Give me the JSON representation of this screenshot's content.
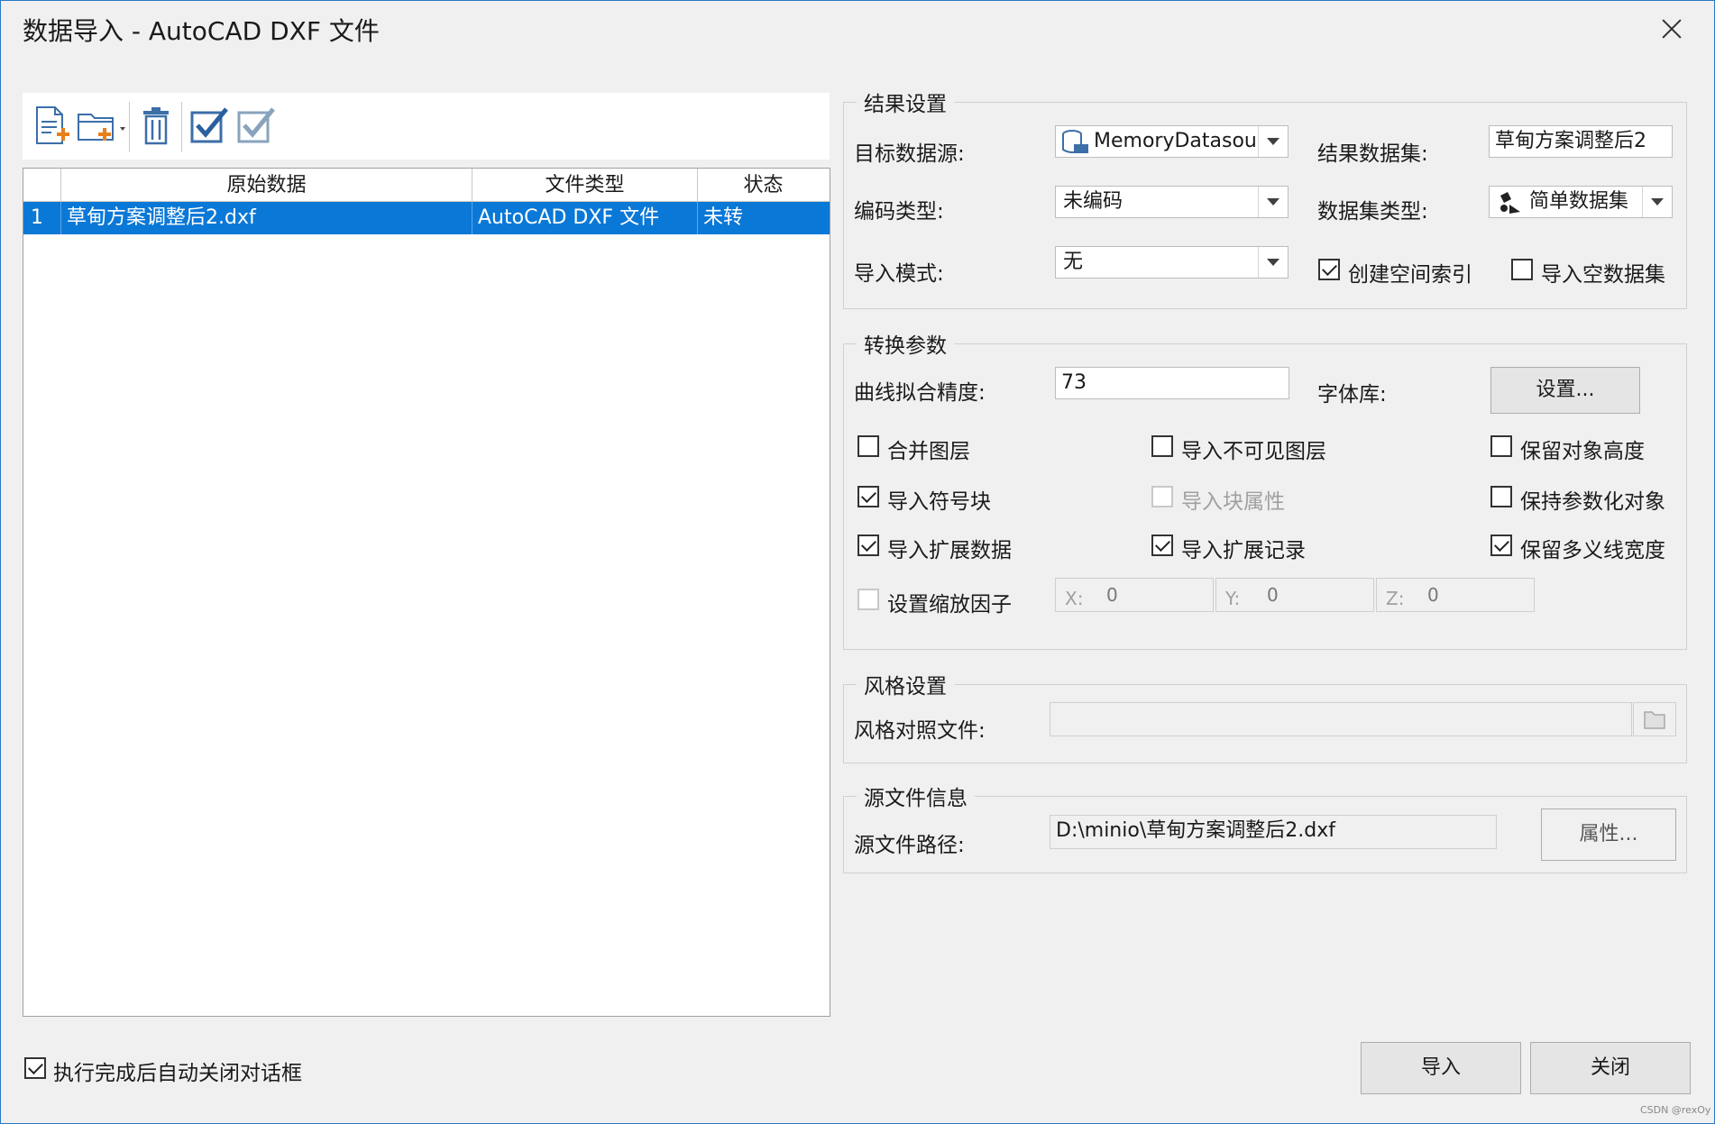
{
  "window": {
    "title": "数据导入 - AutoCAD DXF 文件"
  },
  "toolbar": {
    "icons": [
      "add-file-icon",
      "add-folder-icon",
      "delete-icon",
      "select-all-icon",
      "invert-select-icon"
    ]
  },
  "file_list": {
    "columns": [
      "原始数据",
      "文件类型",
      "状态"
    ],
    "rows": [
      {
        "index": "1",
        "name": "草甸方案调整后2.dxf",
        "type": "AutoCAD DXF 文件",
        "status": "未转"
      }
    ]
  },
  "result_settings": {
    "legend": "结果设置",
    "target_datasource_label": "目标数据源:",
    "target_datasource_value": "MemoryDatasourc",
    "result_dataset_label": "结果数据集:",
    "result_dataset_value": "草甸方案调整后2",
    "encoding_label": "编码类型:",
    "encoding_value": "未编码",
    "dataset_type_label": "数据集类型:",
    "dataset_type_value": "简单数据集",
    "import_mode_label": "导入模式:",
    "import_mode_value": "无",
    "spatial_index_label": "创建空间索引",
    "spatial_index_checked": true,
    "import_empty_label": "导入空数据集",
    "import_empty_checked": false
  },
  "conversion": {
    "legend": "转换参数",
    "curve_precision_label": "曲线拟合精度:",
    "curve_precision_value": "73",
    "font_lib_label": "字体库:",
    "settings_button": "设置...",
    "options": [
      {
        "label": "合并图层",
        "checked": false,
        "enabled": true
      },
      {
        "label": "导入不可见图层",
        "checked": false,
        "enabled": true
      },
      {
        "label": "保留对象高度",
        "checked": false,
        "enabled": true
      },
      {
        "label": "导入符号块",
        "checked": true,
        "enabled": true
      },
      {
        "label": "导入块属性",
        "checked": false,
        "enabled": false
      },
      {
        "label": "保持参数化对象",
        "checked": false,
        "enabled": true
      },
      {
        "label": "导入扩展数据",
        "checked": true,
        "enabled": true
      },
      {
        "label": "导入扩展记录",
        "checked": true,
        "enabled": true
      },
      {
        "label": "保留多义线宽度",
        "checked": true,
        "enabled": true
      }
    ],
    "scale_factor_label": "设置缩放因子",
    "scale_factor_checked": false,
    "x_label": "X:",
    "x_value": "0",
    "y_label": "Y:",
    "y_value": "0",
    "z_label": "Z:",
    "z_value": "0"
  },
  "style": {
    "legend": "风格设置",
    "mapping_file_label": "风格对照文件:",
    "mapping_file_value": ""
  },
  "source": {
    "legend": "源文件信息",
    "path_label": "源文件路径:",
    "path_value": "D:\\minio\\草甸方案调整后2.dxf",
    "properties_button": "属性..."
  },
  "footer": {
    "auto_close_label": "执行完成后自动关闭对话框",
    "auto_close_checked": true,
    "import_button": "导入",
    "close_button": "关闭"
  },
  "watermark": "CSDN @rexOy"
}
